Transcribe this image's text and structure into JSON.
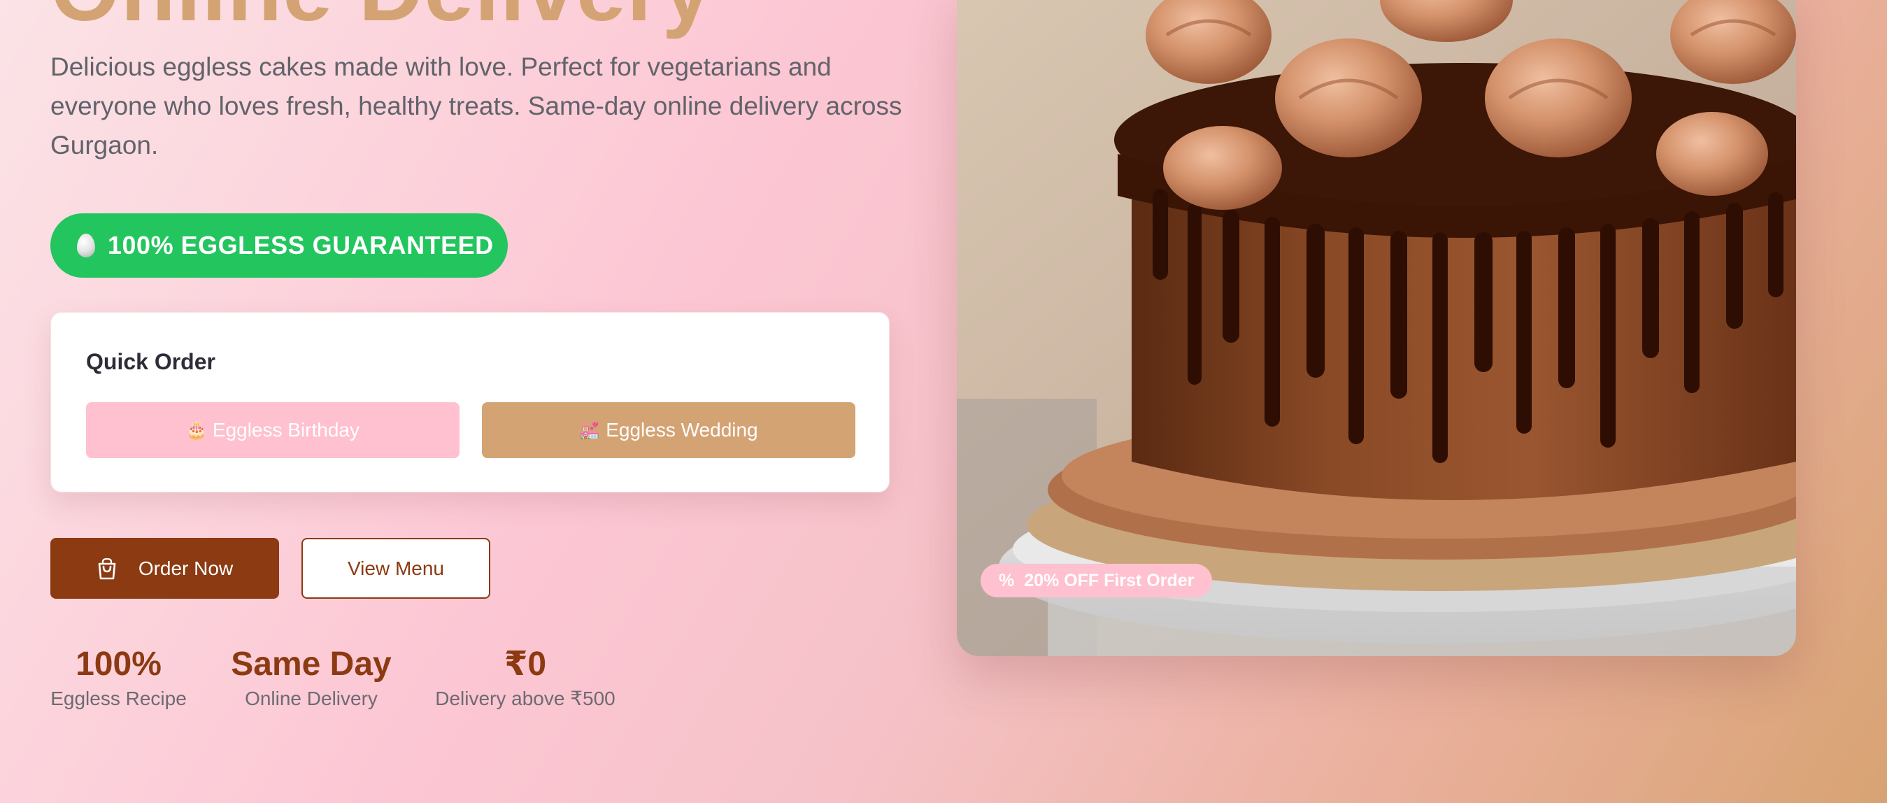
{
  "hero": {
    "title": "Online Delivery",
    "description": "Delicious eggless cakes made with love. Perfect for vegetarians and everyone who loves fresh, healthy treats. Same-day online delivery across Gurgaon."
  },
  "badge": {
    "text": "100% EGGLESS GUARANTEED",
    "icon": "egg-icon",
    "color": "#22c55e"
  },
  "quick_order": {
    "title": "Quick Order",
    "buttons": [
      {
        "emoji": "🎂",
        "label": "Eggless Birthday",
        "color": "#ffc0cf"
      },
      {
        "emoji": "💒",
        "label": "Eggless Wedding",
        "color": "#d4a373"
      }
    ]
  },
  "actions": {
    "order_now": "Order Now",
    "order_icon": "shopping-bag-icon",
    "view_menu": "View Menu"
  },
  "stats": [
    {
      "value": "100%",
      "label": "Eggless Recipe"
    },
    {
      "value": "Same Day",
      "label": "Online Delivery"
    },
    {
      "value": "₹0",
      "label": "Delivery above ₹500"
    }
  ],
  "image": {
    "tag_icon": "%",
    "tag_text": "20% OFF First Order"
  },
  "colors": {
    "brand_brown": "#8b3a12",
    "accent_tan": "#d4a373",
    "accent_pink": "#ffc0cf"
  }
}
